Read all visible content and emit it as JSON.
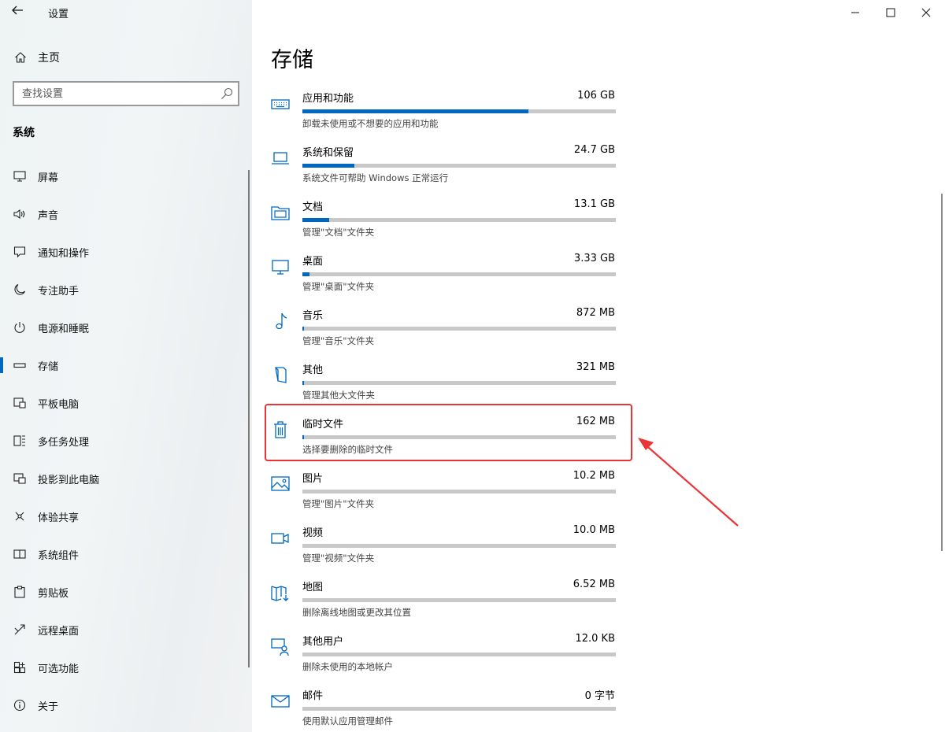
{
  "window": {
    "title": "设置",
    "back_icon": "back-arrow-icon",
    "controls": [
      "minimize-icon",
      "maximize-icon",
      "close-icon"
    ]
  },
  "sidebar": {
    "home_label": "主页",
    "search_placeholder": "查找设置",
    "section_title": "系统",
    "items": [
      {
        "label": "屏幕",
        "icon": "display-icon"
      },
      {
        "label": "声音",
        "icon": "speaker-icon"
      },
      {
        "label": "通知和操作",
        "icon": "notification-icon"
      },
      {
        "label": "专注助手",
        "icon": "moon-icon"
      },
      {
        "label": "电源和睡眠",
        "icon": "power-icon"
      },
      {
        "label": "存储",
        "icon": "storage-icon",
        "active": true
      },
      {
        "label": "平板电脑",
        "icon": "tablet-icon"
      },
      {
        "label": "多任务处理",
        "icon": "multitask-icon"
      },
      {
        "label": "投影到此电脑",
        "icon": "project-icon"
      },
      {
        "label": "体验共享",
        "icon": "share-icon"
      },
      {
        "label": "系统组件",
        "icon": "components-icon"
      },
      {
        "label": "剪贴板",
        "icon": "clipboard-icon"
      },
      {
        "label": "远程桌面",
        "icon": "remote-icon"
      },
      {
        "label": "可选功能",
        "icon": "optional-features-icon"
      },
      {
        "label": "关于",
        "icon": "info-icon"
      }
    ]
  },
  "main": {
    "title": "存储",
    "items": [
      {
        "name": "应用和功能",
        "size": "106 GB",
        "desc": "卸载未使用或不想要的应用和功能",
        "icon": "keyboard-icon",
        "usage": 0.72
      },
      {
        "name": "系统和保留",
        "size": "24.7 GB",
        "desc": "系统文件可帮助 Windows 正常运行",
        "icon": "laptop-icon",
        "usage": 0.165
      },
      {
        "name": "文档",
        "size": "13.1 GB",
        "desc": "管理\"文档\"文件夹",
        "icon": "folder-icon",
        "usage": 0.085
      },
      {
        "name": "桌面",
        "size": "3.33 GB",
        "desc": "管理\"桌面\"文件夹",
        "icon": "monitor-icon",
        "usage": 0.022
      },
      {
        "name": "音乐",
        "size": "872 MB",
        "desc": "管理\"音乐\"文件夹",
        "icon": "music-icon",
        "usage": 0.006
      },
      {
        "name": "其他",
        "size": "321 MB",
        "desc": "管理其他大文件夹",
        "icon": "other-icon",
        "usage": 0.003
      },
      {
        "name": "临时文件",
        "size": "162 MB",
        "desc": "选择要删除的临时文件",
        "icon": "trash-icon",
        "usage": 0.001
      },
      {
        "name": "图片",
        "size": "10.2 MB",
        "desc": "管理\"图片\"文件夹",
        "icon": "picture-icon",
        "usage": 0
      },
      {
        "name": "视频",
        "size": "10.0 MB",
        "desc": "管理\"视频\"文件夹",
        "icon": "video-icon",
        "usage": 0
      },
      {
        "name": "地图",
        "size": "6.52 MB",
        "desc": "删除离线地图或更改其位置",
        "icon": "map-icon",
        "usage": 0
      },
      {
        "name": "其他用户",
        "size": "12.0 KB",
        "desc": "删除未使用的本地帐户",
        "icon": "other-users-icon",
        "usage": 0
      },
      {
        "name": "邮件",
        "size": "0 字节",
        "desc": "使用默认应用管理邮件",
        "icon": "mail-icon",
        "usage": 0
      }
    ]
  },
  "colors": {
    "accent": "#0067c0",
    "highlight": "#e83535",
    "bar_bg": "#c8c8c8"
  }
}
